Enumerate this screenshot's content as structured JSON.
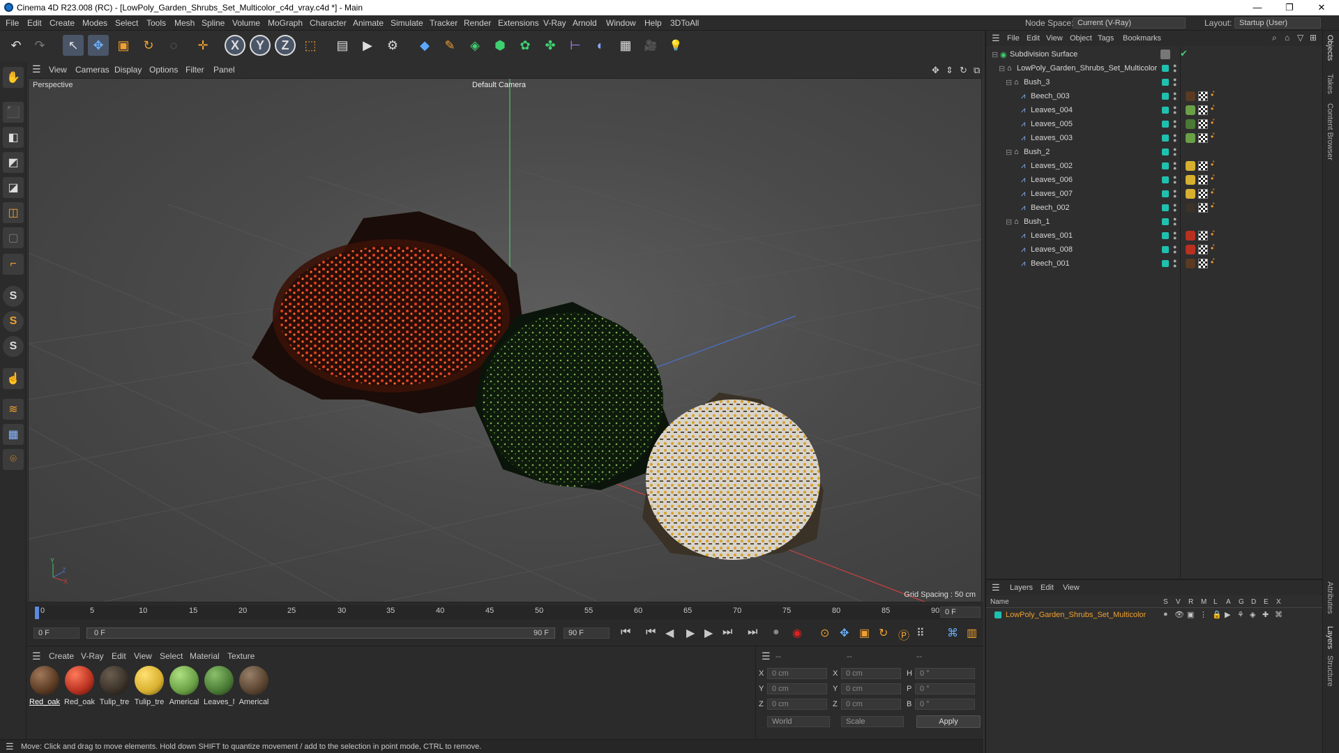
{
  "window": {
    "title": "Cinema 4D R23.008 (RC) - [LowPoly_Garden_Shrubs_Set_Multicolor_c4d_vray.c4d *] - Main",
    "minimize": "—",
    "maximize": "❐",
    "close": "✕"
  },
  "menu": [
    "File",
    "Edit",
    "Create",
    "Modes",
    "Select",
    "Tools",
    "Mesh",
    "Spline",
    "Volume",
    "MoGraph",
    "Character",
    "Animate",
    "Simulate",
    "Tracker",
    "Render",
    "Extensions",
    "V-Ray",
    "Arnold",
    "Window",
    "Help",
    "3DToAll"
  ],
  "nodespace": {
    "label": "Node Space:",
    "value": "Current (V-Ray)"
  },
  "layout": {
    "label": "Layout:",
    "value": "Startup (User)"
  },
  "toolbar": {
    "undo": "↶",
    "redo": "↷",
    "select": "↖",
    "move": "✥",
    "scale": "▣",
    "rotate": "↻",
    "live": "◌",
    "add": "✛",
    "x": "X",
    "y": "Y",
    "z": "Z",
    "coord": "⬚",
    "render_region": "▤",
    "render": "▶",
    "render_settings": "⚙",
    "cube": "◆",
    "pen": "✎",
    "subdiv": "◈",
    "extrude": "⬢",
    "cloner": "✿",
    "deform": "✤",
    "field": "⊢",
    "hair": "◐",
    "floor": "▦",
    "camera": "🎥",
    "light": "💡"
  },
  "leftbar": [
    "✋",
    "⬛",
    "◧",
    "◩",
    "◪",
    "◫",
    "▢",
    "⌐",
    "S",
    "S",
    "S",
    "☝",
    "≋",
    "▦",
    "⌾"
  ],
  "viewport": {
    "menu": [
      "View",
      "Cameras",
      "Display",
      "Options",
      "Filter",
      "Panel"
    ],
    "perspective": "Perspective",
    "camera": "Default Camera",
    "grid_spacing": "Grid Spacing : 50 cm",
    "axes": {
      "y": "Y",
      "z": "Z",
      "x": "X"
    }
  },
  "timeline": {
    "ticks": [
      "0",
      "5",
      "10",
      "15",
      "20",
      "25",
      "30",
      "35",
      "40",
      "45",
      "50",
      "55",
      "60",
      "65",
      "70",
      "75",
      "80",
      "85",
      "90"
    ],
    "current_frame": "0 F",
    "start": "0 F",
    "range_start": "0 F",
    "range_end": "90 F",
    "end": "90 F"
  },
  "material_panel": {
    "menu": [
      "Create",
      "V-Ray",
      "Edit",
      "View",
      "Select",
      "Material",
      "Texture"
    ],
    "materials": [
      {
        "label": "Red_oak",
        "color": "#5a3a22"
      },
      {
        "label": "Red_oak",
        "color": "#b83020"
      },
      {
        "label": "Tulip_tre",
        "color": "#3a3128"
      },
      {
        "label": "Tulip_tre",
        "color": "#d8b030"
      },
      {
        "label": "Americal",
        "color": "#6aa045"
      },
      {
        "label": "Leaves_N",
        "color": "#4a7a35"
      },
      {
        "label": "Americal",
        "color": "#5a4430"
      }
    ]
  },
  "coords": {
    "header": [
      "--",
      "--",
      "--"
    ],
    "rows": [
      {
        "a": "X",
        "av": "0 cm",
        "b": "X",
        "bv": "0 cm",
        "c": "H",
        "cv": "0 °"
      },
      {
        "a": "Y",
        "av": "0 cm",
        "b": "Y",
        "bv": "0 cm",
        "c": "P",
        "cv": "0 °"
      },
      {
        "a": "Z",
        "av": "0 cm",
        "b": "Z",
        "bv": "0 cm",
        "c": "B",
        "cv": "0 °"
      }
    ],
    "world": "World",
    "scale": "Scale",
    "apply": "Apply"
  },
  "status": "Move: Click and drag to move elements. Hold down SHIFT to quantize movement / add to the selection in point mode, CTRL to remove.",
  "objects": {
    "menu": [
      "File",
      "Edit",
      "View",
      "Object",
      "Tags",
      "Bookmarks"
    ],
    "rows": [
      {
        "name": "Subdivision Surface",
        "indent": 0
      },
      {
        "name": "LowPoly_Garden_Shrubs_Set_Multicolor",
        "indent": 1
      },
      {
        "name": "Bush_3",
        "indent": 2
      },
      {
        "name": "Beech_003",
        "indent": 3,
        "mat": "#5a3a22"
      },
      {
        "name": "Leaves_004",
        "indent": 3,
        "mat": "#6aa045"
      },
      {
        "name": "Leaves_005",
        "indent": 3,
        "mat": "#4a7a35"
      },
      {
        "name": "Leaves_003",
        "indent": 3,
        "mat": "#6aa045"
      },
      {
        "name": "Bush_2",
        "indent": 2
      },
      {
        "name": "Leaves_002",
        "indent": 3,
        "mat": "#d8b030"
      },
      {
        "name": "Leaves_006",
        "indent": 3,
        "mat": "#d8b030"
      },
      {
        "name": "Leaves_007",
        "indent": 3,
        "mat": "#d8b030"
      },
      {
        "name": "Beech_002",
        "indent": 3,
        "mat": "#3a3128"
      },
      {
        "name": "Bush_1",
        "indent": 2
      },
      {
        "name": "Leaves_001",
        "indent": 3,
        "mat": "#b83020"
      },
      {
        "name": "Leaves_008",
        "indent": 3,
        "mat": "#b83020"
      },
      {
        "name": "Beech_001",
        "indent": 3,
        "mat": "#5a3a22"
      }
    ]
  },
  "layers": {
    "menu": [
      "Layers",
      "Edit",
      "View"
    ],
    "columns": [
      "Name",
      "S",
      "V",
      "R",
      "M",
      "L",
      "A",
      "G",
      "D",
      "E",
      "X"
    ],
    "layer_name": "LowPoly_Garden_Shrubs_Set_Multicolor"
  },
  "side_tabs": [
    "Objects",
    "Takes",
    "Content Browser",
    "Attributes",
    "Layers",
    "Structure"
  ]
}
